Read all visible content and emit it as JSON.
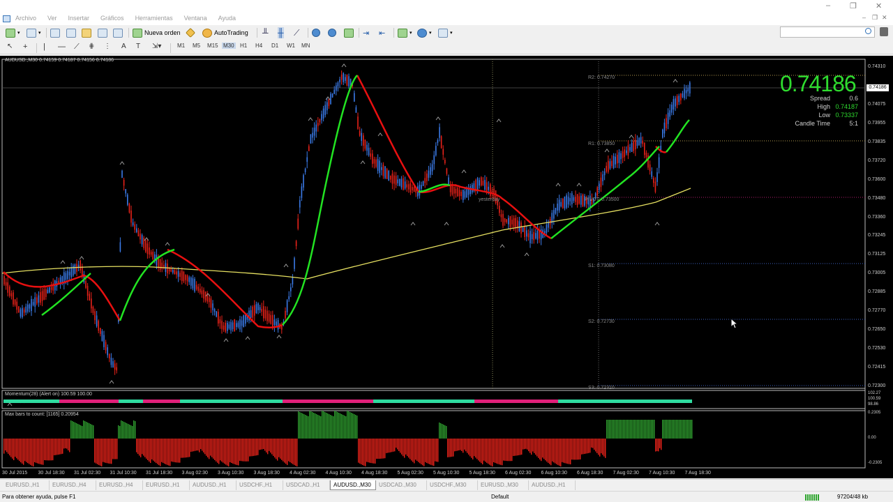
{
  "menu": {
    "items": [
      "Archivo",
      "Ver",
      "Insertar",
      "Gráficos",
      "Herramientas",
      "Ventana",
      "Ayuda"
    ]
  },
  "toolbar": {
    "new_order_label": "Nueva orden",
    "autotrading_label": "AutoTrading",
    "timeframes": [
      "M1",
      "M5",
      "M15",
      "M30",
      "H1",
      "H4",
      "D1",
      "W1",
      "MN"
    ],
    "active_timeframe": "M30",
    "search_placeholder": ""
  },
  "chart": {
    "header": "AUDUSD.,M30  0.74159 0.74187 0.74156 0.74186",
    "symbol": "AUDUSD.",
    "timeframe": "M30",
    "current_price": "0.74186",
    "info": {
      "spread_label": "Spread",
      "spread_value": "0.6",
      "high_label": "High",
      "high_value": "0.74187",
      "low_label": "Low",
      "low_value": "0.73337",
      "candle_time_label": "Candle Time",
      "candle_time_value": "5:1"
    },
    "pivots": {
      "r2": "R2: 0.74270",
      "r1": "R1: 0.73850",
      "pivot": "PIVOT: 0.73500",
      "s1": "S1: 0.73080",
      "s2": "S2: 0.72730",
      "s3": "S3: 0.72310",
      "yesterday": "yesterday"
    },
    "price_scale": [
      "0.74310",
      "0.74186",
      "0.74075",
      "0.73955",
      "0.73835",
      "0.73720",
      "0.73600",
      "0.73480",
      "0.73360",
      "0.73245",
      "0.73125",
      "0.73005",
      "0.72885",
      "0.72770",
      "0.72650",
      "0.72530",
      "0.72415",
      "0.72300"
    ],
    "time_scale": [
      "30 Jul 2015",
      "30 Jul 18:30",
      "31 Jul 02:30",
      "31 Jul 10:30",
      "31 Jul 18:30",
      "3 Aug 02:30",
      "3 Aug 10:30",
      "3 Aug 18:30",
      "4 Aug 02:30",
      "4 Aug 10:30",
      "4 Aug 18:30",
      "5 Aug 02:30",
      "5 Aug 10:30",
      "5 Aug 18:30",
      "6 Aug 02:30",
      "6 Aug 10:30",
      "6 Aug 18:30",
      "7 Aug 02:30",
      "7 Aug 10:30",
      "7 Aug 18:30"
    ],
    "colors": {
      "background": "#000000",
      "bull_candle": "#3b7be8",
      "bear_candle": "#e8221a",
      "ma_up": "#22e322",
      "ma_down": "#e81010",
      "ma_slow": "#e6e061",
      "price_text": "#2fdc2f"
    }
  },
  "indicator1": {
    "title": "Momentum(28) (Alert on) 100.59 100.00",
    "scale": [
      "102.27",
      "100.59",
      "98.86"
    ]
  },
  "indicator2": {
    "title": "Max bars to count: [1165]  0.20954",
    "scale": [
      "0.2305",
      "0.00",
      "-0.2305"
    ]
  },
  "tabs": [
    "EURUSD.,H1",
    "EURUSD.,H4",
    "EURUSD.,H4",
    "EURUSD.,H1",
    "AUDUSD.,H1",
    "USDCHF.,H1",
    "USDCAD.,H1",
    "AUDUSD.,M30",
    "USDCAD.,M30",
    "USDCHF.,M30",
    "EURUSD.,M30",
    "AUDUSD.,H1"
  ],
  "active_tab": "AUDUSD.,M30",
  "status": {
    "help_text": "Para obtener ayuda, pulse F1",
    "profile": "Default",
    "traffic": "97204/48 kb"
  }
}
